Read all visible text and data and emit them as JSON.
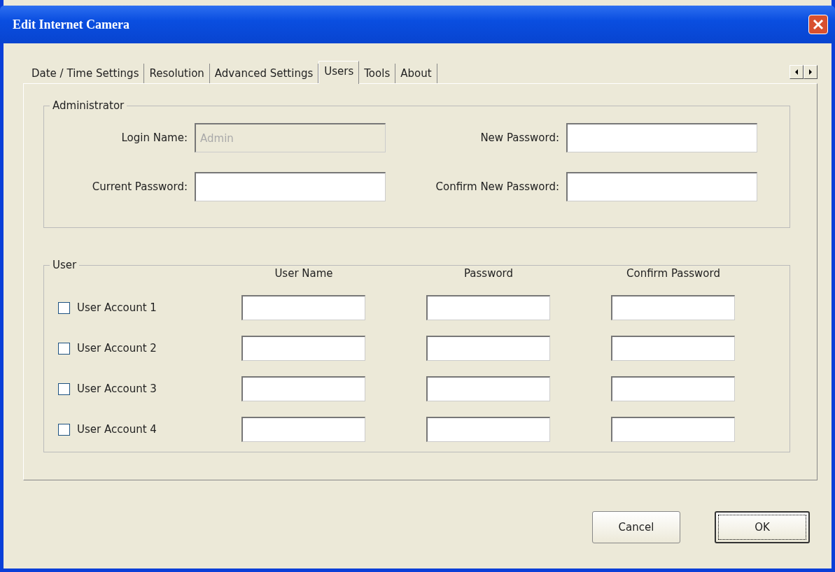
{
  "window": {
    "title": "Edit Internet Camera"
  },
  "tabs": [
    {
      "label": "Date / Time Settings",
      "selected": false
    },
    {
      "label": "Resolution",
      "selected": false
    },
    {
      "label": "Advanced Settings",
      "selected": false
    },
    {
      "label": "Users",
      "selected": true
    },
    {
      "label": "Tools",
      "selected": false
    },
    {
      "label": "About",
      "selected": false
    }
  ],
  "administrator": {
    "title": "Administrator",
    "fields": [
      {
        "label": "Login Name:",
        "value": "Admin",
        "disabled": true
      },
      {
        "label": "New Password:",
        "disabled": false
      },
      {
        "label": "Current Password:",
        "disabled": false
      },
      {
        "label": "Confirm New Password:",
        "disabled": false
      }
    ]
  },
  "user": {
    "title": "User",
    "columns": [
      "User Name",
      "Password",
      "Confirm Password"
    ],
    "accounts": [
      {
        "label": "User Account 1",
        "checked": false
      },
      {
        "label": "User Account 2",
        "checked": false
      },
      {
        "label": "User Account 3",
        "checked": false
      },
      {
        "label": "User Account 4",
        "checked": false
      }
    ]
  },
  "buttons": [
    {
      "label": "Cancel",
      "default": false
    },
    {
      "label": "OK",
      "default": true
    }
  ]
}
